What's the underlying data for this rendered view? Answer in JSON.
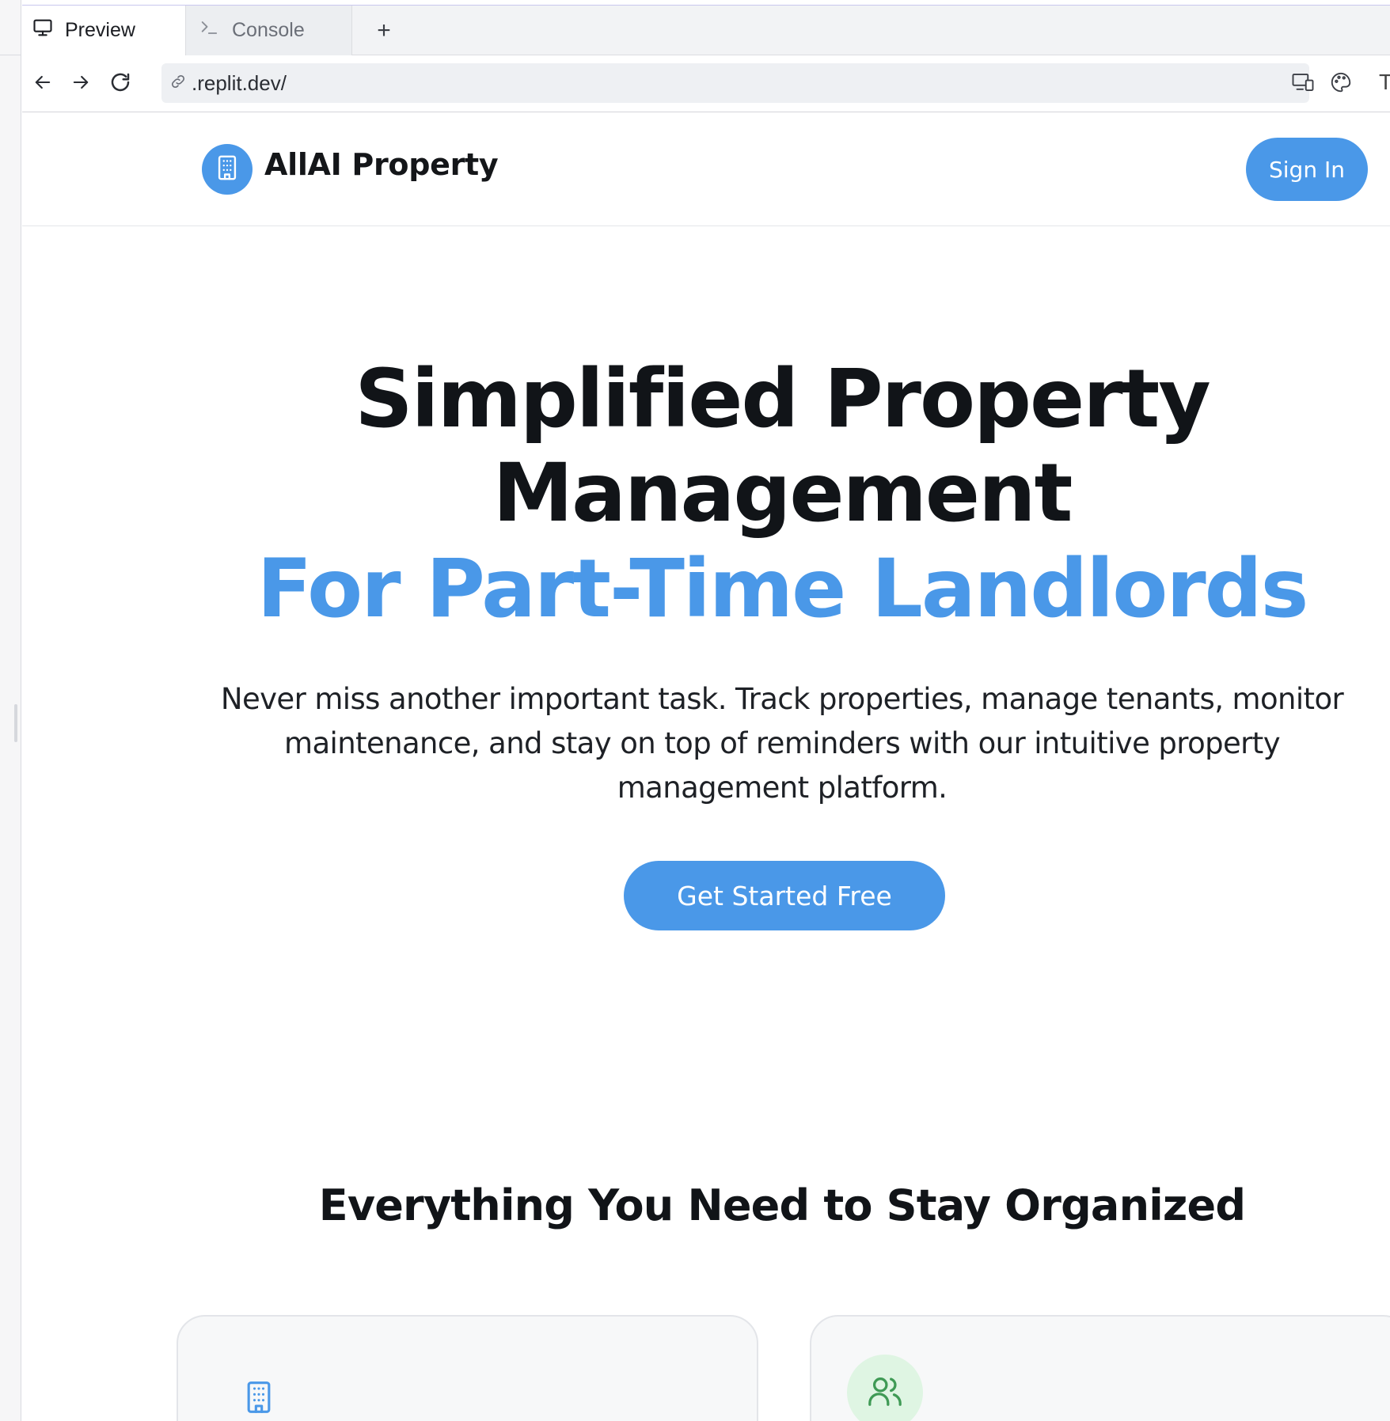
{
  "browser": {
    "tabs": [
      {
        "label": "Preview",
        "icon": "monitor-icon",
        "active": true
      },
      {
        "label": "Console",
        "icon": "terminal-icon",
        "active": false
      }
    ],
    "new_tab_label": "+",
    "url": ".replit.dev/",
    "clipped_tool_label": "T"
  },
  "site": {
    "brand": "AllAI Property",
    "signin_label": "Sign In",
    "hero": {
      "line1": "Simplified Property",
      "line2": "Management",
      "line3": "For Part-Time Landlords",
      "subtitle": "Never miss another important task. Track properties, manage tenants, monitor maintenance, and stay on top of reminders with our intuitive property management platform.",
      "cta_label": "Get Started Free"
    },
    "features_title": "Everything You Need to Stay Organized",
    "feature_cards": [
      {
        "icon": "building-icon"
      },
      {
        "icon": "users-icon"
      }
    ]
  },
  "colors": {
    "accent": "#4a98e8",
    "heading": "#111418",
    "green_tint": "#dff5e3",
    "green_icon": "#3f9a55"
  }
}
